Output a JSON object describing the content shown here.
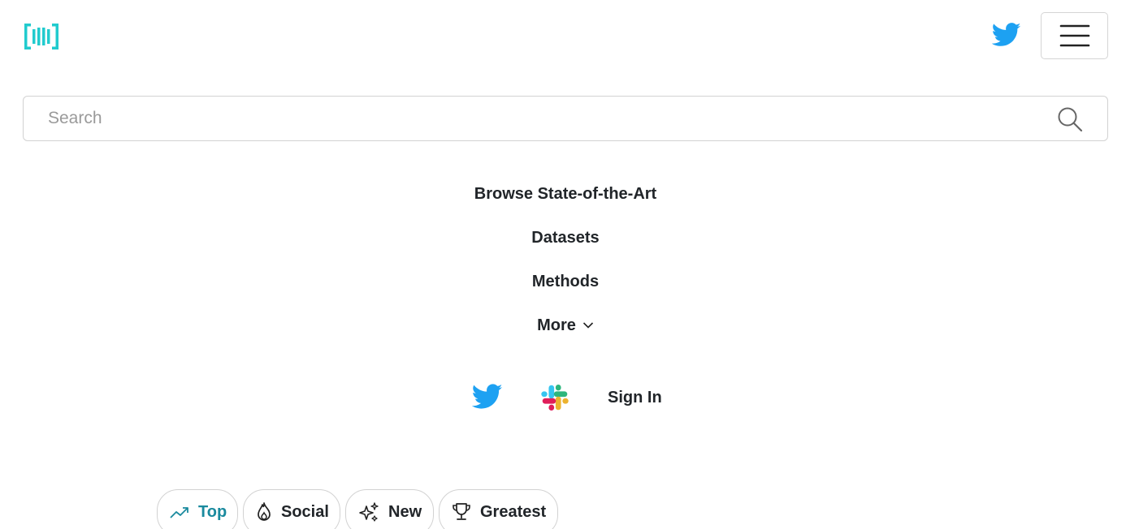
{
  "header": {
    "logo_icon": "paperswithcode-logo-icon",
    "twitter_icon": "twitter-icon",
    "menu_icon": "hamburger-menu-icon"
  },
  "search": {
    "placeholder": "Search",
    "value": "",
    "icon": "search-icon"
  },
  "nav": {
    "items": [
      {
        "label": "Browse State-of-the-Art"
      },
      {
        "label": "Datasets"
      },
      {
        "label": "Methods"
      },
      {
        "label": "More"
      }
    ],
    "more_icon": "chevron-down-icon"
  },
  "social": {
    "twitter_icon": "twitter-icon",
    "slack_icon": "slack-icon",
    "signin_label": "Sign In"
  },
  "filters": [
    {
      "label": "Top",
      "icon": "trending-up-icon",
      "active": true
    },
    {
      "label": "Social",
      "icon": "flame-icon",
      "active": false
    },
    {
      "label": "New",
      "icon": "sparkles-icon",
      "active": false
    },
    {
      "label": "Greatest",
      "icon": "trophy-icon",
      "active": false
    }
  ],
  "colors": {
    "brand": "#21cbce",
    "twitter": "#1da1f2",
    "active_filter": "#1a8a9e"
  }
}
